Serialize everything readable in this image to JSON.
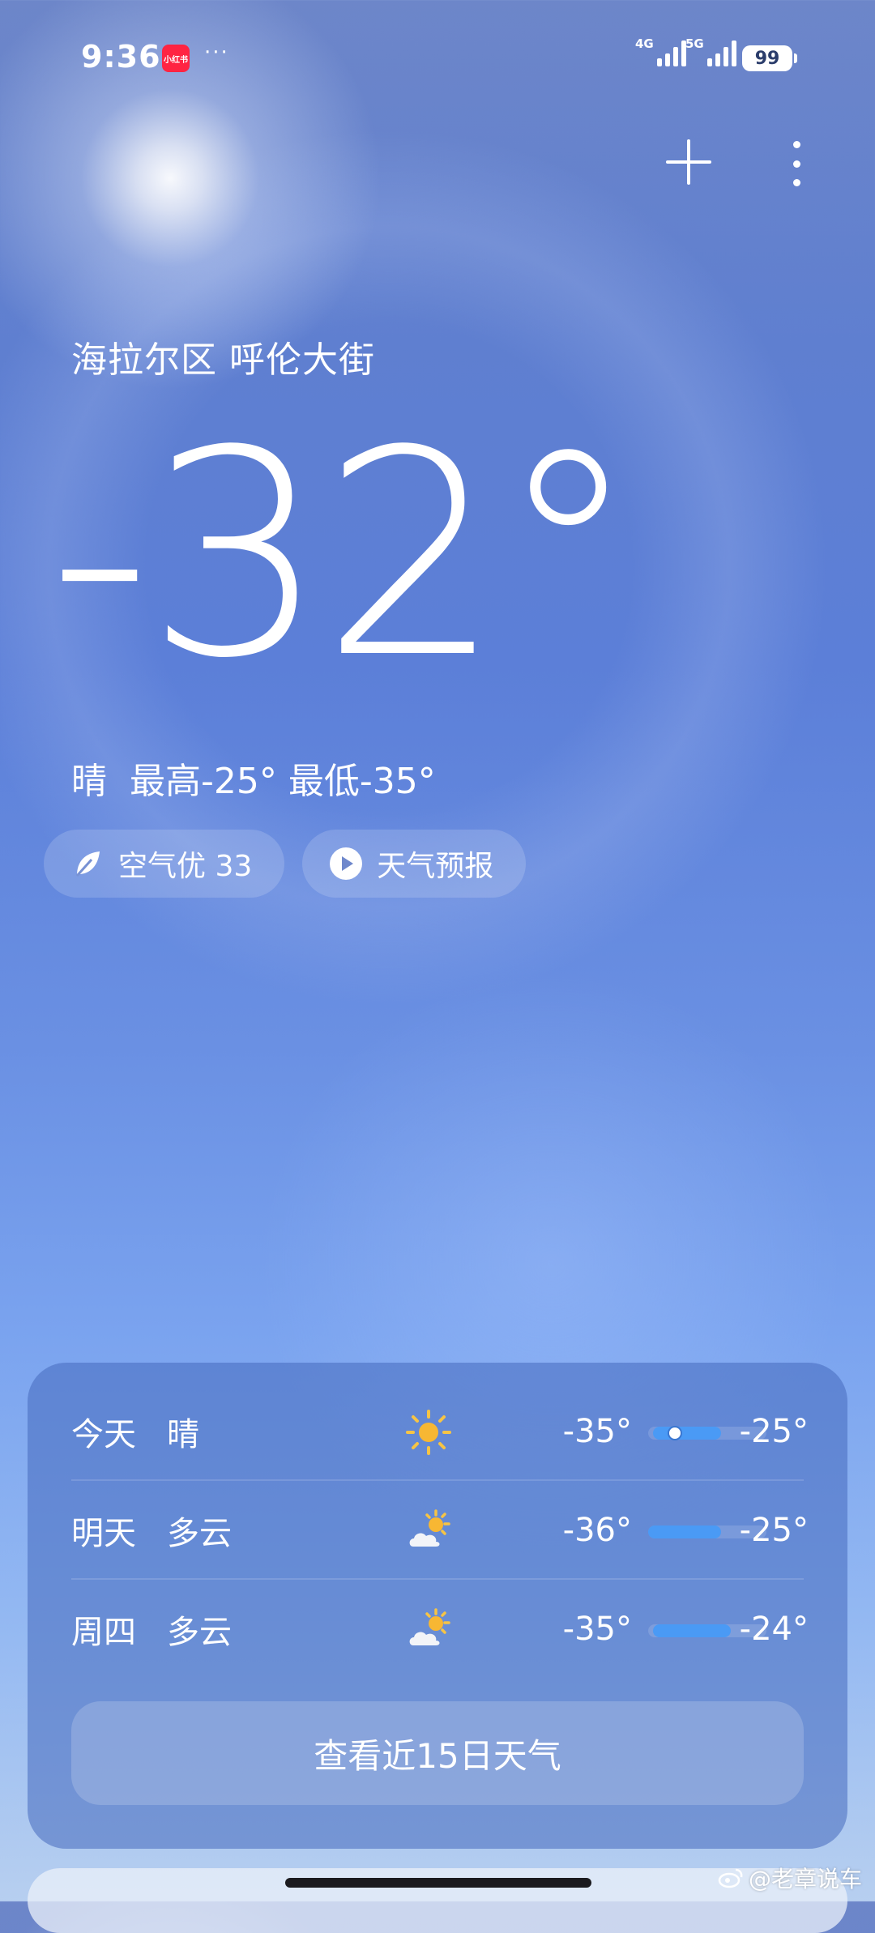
{
  "status_bar": {
    "time": "9:36",
    "app_badge": "小红书",
    "more": "···",
    "net1": "4G",
    "net2": "5G",
    "battery": "99",
    "icons": [
      "signal-4g-icon",
      "signal-5g-icon",
      "battery-icon"
    ]
  },
  "header": {
    "add_icon": "plus-icon",
    "menu_icon": "more-vertical-icon"
  },
  "weather": {
    "location": "海拉尔区 呼伦大街",
    "temperature": "-32°",
    "condition": "晴",
    "high": "最高-25°",
    "low": "最低-35°"
  },
  "pills": {
    "air_quality": "空气优 33",
    "forecast_video": "天气预报"
  },
  "forecast": {
    "days": [
      {
        "day": "今天",
        "condition": "晴",
        "icon": "sun-icon",
        "low": "-35°",
        "high": "-25°"
      },
      {
        "day": "明天",
        "condition": "多云",
        "icon": "partly-cloudy-icon",
        "low": "-36°",
        "high": "-25°"
      },
      {
        "day": "周四",
        "condition": "多云",
        "icon": "partly-cloudy-icon",
        "low": "-35°",
        "high": "-24°"
      }
    ],
    "button_label": "查看近15日天气"
  },
  "watermark": "@老章说车",
  "colors": {
    "range_fill": "#4a9af5",
    "badge_red": "#ff2442"
  }
}
